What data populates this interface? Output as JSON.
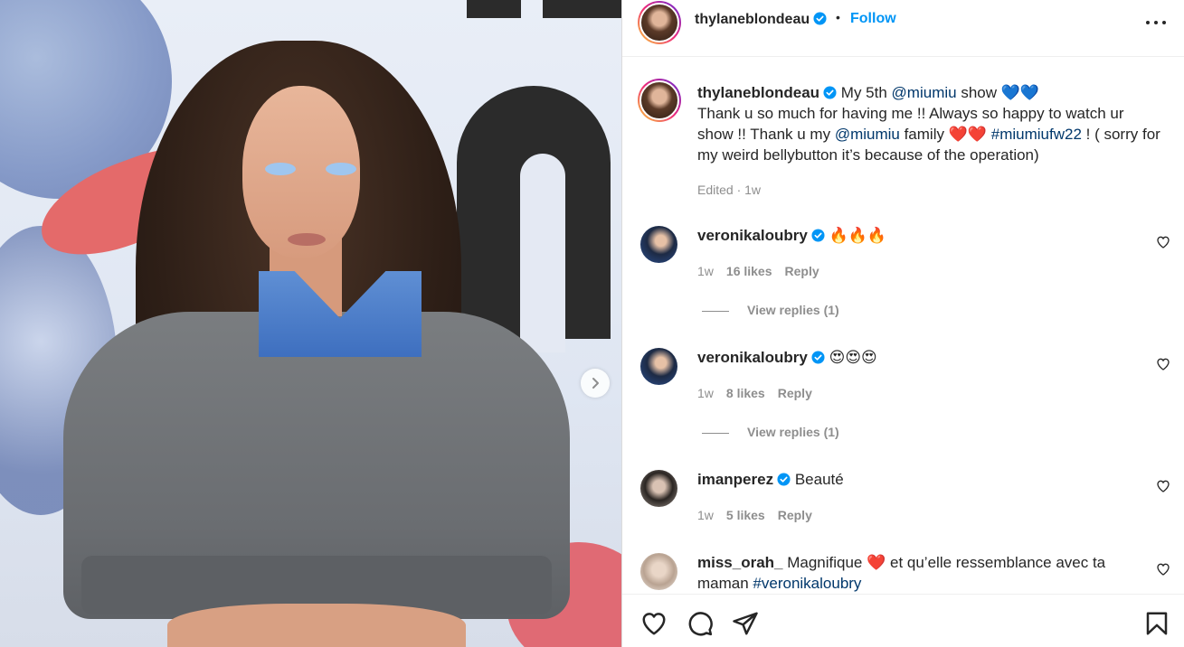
{
  "post": {
    "author": "thylaneblondeau",
    "separator": "•",
    "follow_label": "Follow"
  },
  "caption": {
    "author": "thylaneblondeau",
    "p1": " My 5th ",
    "mention1": "@miumiu",
    "p2": " show 💙💙",
    "p3": "Thank u so much for having me !! Always so happy to watch ur show !! Thank u my ",
    "mention2": "@miumiu",
    "p4": " family ❤️❤️ ",
    "hashtag": "#miumiufw22",
    "p5": " ! ( sorry for my weird bellybutton it’s because of the operation)",
    "meta": "Edited · 1w"
  },
  "comments": [
    {
      "user": "veronikaloubry",
      "text": " 🔥🔥🔥",
      "time": "1w",
      "likes": "16 likes",
      "reply": "Reply",
      "view_replies": "View replies (1)"
    },
    {
      "user": "veronikaloubry",
      "text": " 😍😍😍",
      "time": "1w",
      "likes": "8 likes",
      "reply": "Reply",
      "view_replies": "View replies (1)"
    },
    {
      "user": "imanperez",
      "text": " Beauté",
      "time": "1w",
      "likes": "5 likes",
      "reply": "Reply"
    },
    {
      "user": "miss_orah_",
      "text": " Magnifique ❤️ et qu’elle ressemblance avec ta maman ",
      "hashtag": "#veronikaloubry"
    }
  ],
  "icons": {
    "verified": "verified-badge-icon",
    "more": "more-options-icon",
    "like": "heart-icon",
    "comment": "comment-icon",
    "share": "send-icon",
    "save": "bookmark-icon",
    "next": "chevron-right-icon"
  },
  "colors": {
    "accent": "#0095f6",
    "link": "#00376b",
    "verified": "#0095f6"
  }
}
